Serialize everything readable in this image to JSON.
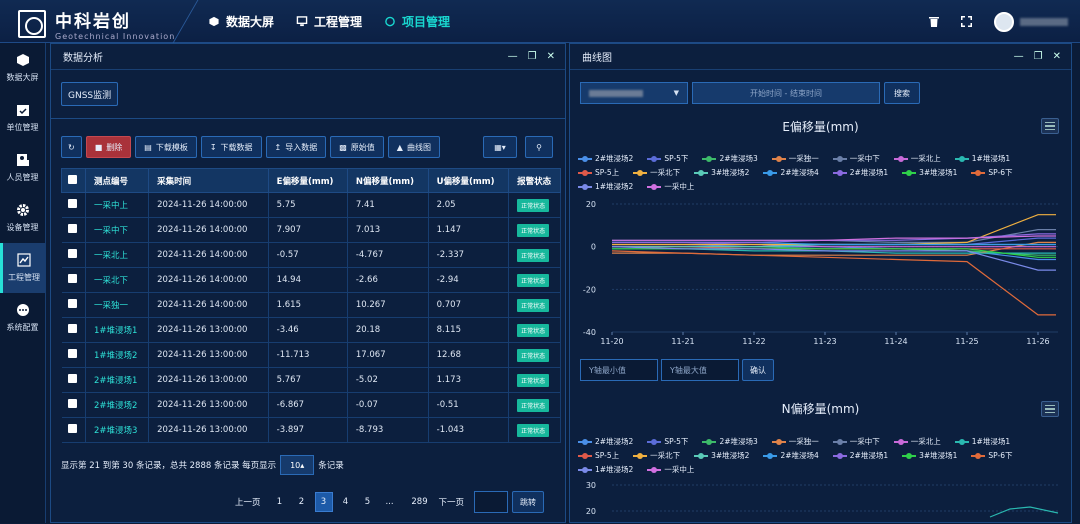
{
  "app": {
    "title": "中科岩创",
    "subtitle": "Geotechnical Innovation"
  },
  "nav": [
    {
      "label": "数据大屏",
      "active": false
    },
    {
      "label": "工程管理",
      "active": false
    },
    {
      "label": "项目管理",
      "active": true
    }
  ],
  "sidebar": [
    {
      "label": "数据大屏",
      "icon": "cube-icon"
    },
    {
      "label": "单位管理",
      "icon": "calendar-check-icon"
    },
    {
      "label": "人员管理",
      "icon": "person-card-icon"
    },
    {
      "label": "设备管理",
      "icon": "gear-icon"
    },
    {
      "label": "工程管理",
      "icon": "chart-icon",
      "active": true
    },
    {
      "label": "系统配置",
      "icon": "more-icon"
    }
  ],
  "left_panel": {
    "title": "数据分析",
    "tab": "GNSS监测",
    "toolbar": [
      "删除",
      "下载模板",
      "下载数据",
      "导入数据",
      "原始值",
      "曲线图"
    ],
    "table": {
      "headers": [
        "测点编号",
        "采集时间",
        "E偏移量(mm)",
        "N偏移量(mm)",
        "U偏移量(mm)",
        "报警状态"
      ],
      "rows": [
        [
          "一采中上",
          "2024-11-26 14:00:00",
          "5.75",
          "7.41",
          "2.05",
          "正常状态"
        ],
        [
          "一采中下",
          "2024-11-26 14:00:00",
          "7.907",
          "7.013",
          "1.147",
          "正常状态"
        ],
        [
          "一采北上",
          "2024-11-26 14:00:00",
          "-0.57",
          "-4.767",
          "-2.337",
          "正常状态"
        ],
        [
          "一采北下",
          "2024-11-26 14:00:00",
          "14.94",
          "-2.66",
          "-2.94",
          "正常状态"
        ],
        [
          "一采独一",
          "2024-11-26 14:00:00",
          "1.615",
          "10.267",
          "0.707",
          "正常状态"
        ],
        [
          "1#堆浸场1",
          "2024-11-26 13:00:00",
          "-3.46",
          "20.18",
          "8.115",
          "正常状态"
        ],
        [
          "1#堆浸场2",
          "2024-11-26 13:00:00",
          "-11.713",
          "17.067",
          "12.68",
          "正常状态"
        ],
        [
          "2#堆浸场1",
          "2024-11-26 13:00:00",
          "5.767",
          "-5.02",
          "1.173",
          "正常状态"
        ],
        [
          "2#堆浸场2",
          "2024-11-26 13:00:00",
          "-6.867",
          "-0.07",
          "-0.51",
          "正常状态"
        ],
        [
          "2#堆浸场3",
          "2024-11-26 13:00:00",
          "-3.897",
          "-8.793",
          "-1.043",
          "正常状态"
        ]
      ]
    },
    "page_info_prefix": "显示第 21 到第 30 条记录，总共 2888 条记录 每页显示",
    "page_size": "10",
    "page_info_suffix": "条记录",
    "pager": {
      "prev": "上一页",
      "pages": [
        "1",
        "2",
        "3",
        "4",
        "5",
        "...",
        "289"
      ],
      "active": "3",
      "next": "下一页",
      "jump": "跳转"
    }
  },
  "right_panel": {
    "title": "曲线图",
    "date_placeholder": "开始时间 - 结束时间",
    "search": "搜索",
    "y_min_placeholder": "Y轴最小值",
    "y_max_placeholder": "Y轴最大值",
    "confirm": "确认",
    "series": [
      {
        "name": "2#堆浸场2",
        "color": "#4a8fe8"
      },
      {
        "name": "SP-5下",
        "color": "#5b6cd8"
      },
      {
        "name": "2#堆浸场3",
        "color": "#3dbb6a"
      },
      {
        "name": "一采独一",
        "color": "#e0834a"
      },
      {
        "name": "一采中下",
        "color": "#6a7fa8"
      },
      {
        "name": "一采北上",
        "color": "#c86ad8"
      },
      {
        "name": "1#堆浸场1",
        "color": "#2ab8b0"
      },
      {
        "name": "SP-5上",
        "color": "#e05a4a"
      },
      {
        "name": "一采北下",
        "color": "#f0b040"
      },
      {
        "name": "3#堆浸场2",
        "color": "#5acab8"
      },
      {
        "name": "2#堆浸场4",
        "color": "#3a9ae8"
      },
      {
        "name": "2#堆浸场1",
        "color": "#8a6ae0"
      },
      {
        "name": "3#堆浸场1",
        "color": "#2fd04a"
      },
      {
        "name": "SP-6下",
        "color": "#e06a3a"
      },
      {
        "name": "1#堆浸场2",
        "color": "#7a8ae8"
      },
      {
        "name": "一采中上",
        "color": "#d070e0"
      }
    ]
  },
  "chart_data": [
    {
      "type": "line",
      "title": "E偏移量(mm)",
      "x": [
        "11-20",
        "11-21",
        "11-22",
        "11-23",
        "11-24",
        "11-25",
        "11-26"
      ],
      "ylim": [
        -40,
        20
      ],
      "yticks": [
        20,
        0,
        -20,
        -40
      ],
      "series": [
        {
          "name": "2#堆浸场2",
          "values": [
            1,
            1,
            0,
            0,
            -1,
            -2,
            -6
          ]
        },
        {
          "name": "SP-5下",
          "values": [
            2,
            2,
            1,
            1,
            1,
            1,
            4
          ]
        },
        {
          "name": "2#堆浸场3",
          "values": [
            0,
            0,
            0,
            -1,
            -1,
            -2,
            -4
          ]
        },
        {
          "name": "一采独一",
          "values": [
            -3,
            -3,
            -4,
            -4,
            -4,
            -4,
            2
          ]
        },
        {
          "name": "一采中下",
          "values": [
            3,
            3,
            3,
            3,
            2,
            2,
            8
          ]
        },
        {
          "name": "一采北上",
          "values": [
            1,
            1,
            1,
            0,
            0,
            0,
            0
          ]
        },
        {
          "name": "1#堆浸场1",
          "values": [
            -1,
            -1,
            -2,
            -2,
            -3,
            -3,
            -3
          ]
        },
        {
          "name": "SP-5上",
          "values": [
            0,
            0,
            -1,
            -1,
            -1,
            -1,
            -1
          ]
        },
        {
          "name": "一采北下",
          "values": [
            1,
            1,
            1,
            1,
            1,
            2,
            15
          ]
        },
        {
          "name": "3#堆浸场2",
          "values": [
            0,
            0,
            0,
            1,
            1,
            1,
            1
          ]
        },
        {
          "name": "2#堆浸场4",
          "values": [
            2,
            2,
            2,
            1,
            1,
            1,
            1
          ]
        },
        {
          "name": "2#堆浸场1",
          "values": [
            2,
            2,
            2,
            3,
            3,
            4,
            6
          ]
        },
        {
          "name": "3#堆浸场1",
          "values": [
            -1,
            -1,
            -1,
            -1,
            -1,
            -1,
            -5
          ]
        },
        {
          "name": "SP-6下",
          "values": [
            -2,
            -3,
            -4,
            -5,
            -6,
            -7,
            -32
          ]
        },
        {
          "name": "1#堆浸场2",
          "values": [
            0,
            -1,
            -1,
            -2,
            -2,
            -2,
            -11
          ]
        },
        {
          "name": "一采中上",
          "values": [
            3,
            3,
            3,
            3,
            4,
            4,
            5
          ]
        }
      ]
    },
    {
      "type": "line",
      "title": "N偏移量(mm)",
      "yticks": [
        30,
        20
      ]
    }
  ]
}
